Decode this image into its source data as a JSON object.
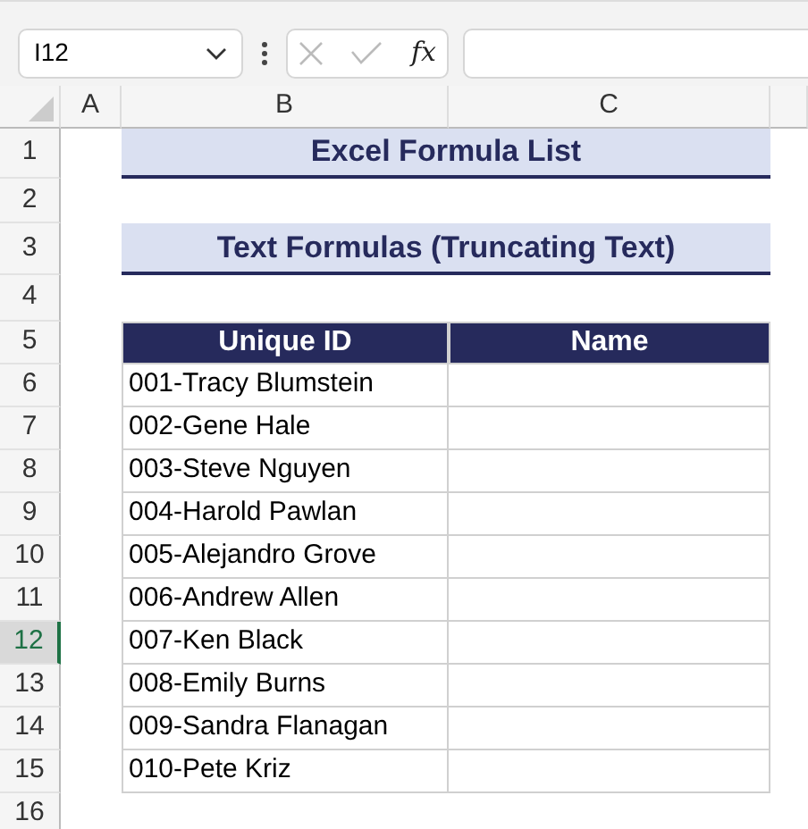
{
  "name_box": {
    "value": "I12"
  },
  "formula_bar": {
    "function_label": "fx"
  },
  "column_headers": [
    {
      "label": "A"
    },
    {
      "label": "B"
    },
    {
      "label": "C"
    }
  ],
  "row_headers": [
    {
      "label": "1",
      "selected": false
    },
    {
      "label": "2",
      "selected": false
    },
    {
      "label": "3",
      "selected": false
    },
    {
      "label": "4",
      "selected": false
    },
    {
      "label": "5",
      "selected": false
    },
    {
      "label": "6",
      "selected": false
    },
    {
      "label": "7",
      "selected": false
    },
    {
      "label": "8",
      "selected": false
    },
    {
      "label": "9",
      "selected": false
    },
    {
      "label": "10",
      "selected": false
    },
    {
      "label": "11",
      "selected": false
    },
    {
      "label": "12",
      "selected": true
    },
    {
      "label": "13",
      "selected": false
    },
    {
      "label": "14",
      "selected": false
    },
    {
      "label": "15",
      "selected": false
    },
    {
      "label": "16",
      "selected": false
    }
  ],
  "title": "Excel Formula List",
  "subtitle": "Text Formulas (Truncating Text)",
  "table": {
    "columns": [
      "Unique ID",
      "Name"
    ],
    "rows": [
      {
        "unique_id": "001-Tracy Blumstein"
      },
      {
        "unique_id": "002-Gene Hale"
      },
      {
        "unique_id": "003-Steve Nguyen"
      },
      {
        "unique_id": "004-Harold Pawlan"
      },
      {
        "unique_id": "005-Alejandro Grove"
      },
      {
        "unique_id": "006-Andrew Allen"
      },
      {
        "unique_id": "007-Ken Black"
      },
      {
        "unique_id": "008-Emily Burns"
      },
      {
        "unique_id": "009-Sandra Flanagan"
      },
      {
        "unique_id": "010-Pete Kriz"
      }
    ]
  }
}
